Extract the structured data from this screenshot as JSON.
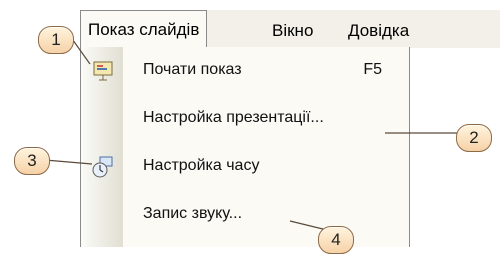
{
  "menubar": {
    "items": [
      {
        "label": "Показ слайдів",
        "accent": "#8a8a8a"
      },
      {
        "label": "Вікно"
      },
      {
        "label": "Довідка"
      }
    ]
  },
  "menu": {
    "items": [
      {
        "label": "Почати показ",
        "shortcut": "F5",
        "icon": "presentation-icon"
      },
      {
        "label": "Настройка презентації...",
        "shortcut": "",
        "icon": ""
      },
      {
        "label": "Настройка часу",
        "shortcut": "",
        "icon": "timing-icon"
      },
      {
        "label": "Запис звуку...",
        "shortcut": "",
        "icon": ""
      }
    ]
  },
  "callouts": [
    {
      "label": "1"
    },
    {
      "label": "2"
    },
    {
      "label": "3"
    },
    {
      "label": "4"
    }
  ]
}
